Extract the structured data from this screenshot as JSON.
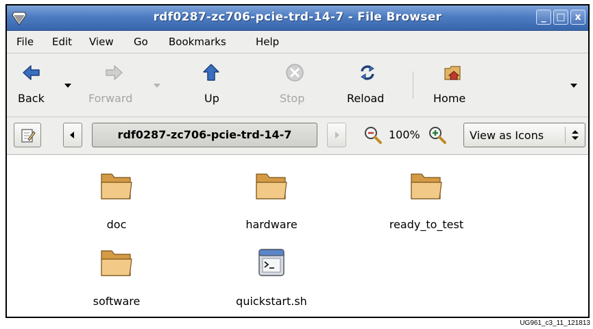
{
  "window": {
    "title": "rdf0287-zc706-pcie-trd-14-7 - File Browser"
  },
  "window_buttons": {
    "minimize": "_",
    "maximize": "□",
    "close": "x"
  },
  "menubar": {
    "items": [
      {
        "label": "File"
      },
      {
        "label": "Edit"
      },
      {
        "label": "View"
      },
      {
        "label": "Go"
      },
      {
        "label": "Bookmarks"
      },
      {
        "label": "Help"
      }
    ]
  },
  "toolbar": {
    "back": {
      "label": "Back",
      "icon": "back-arrow-icon",
      "enabled": true
    },
    "forward": {
      "label": "Forward",
      "icon": "forward-arrow-icon",
      "enabled": false
    },
    "up": {
      "label": "Up",
      "icon": "up-arrow-icon",
      "enabled": true
    },
    "stop": {
      "label": "Stop",
      "icon": "stop-icon",
      "enabled": false
    },
    "reload": {
      "label": "Reload",
      "icon": "reload-icon",
      "enabled": true
    },
    "home": {
      "label": "Home",
      "icon": "home-icon",
      "enabled": true
    }
  },
  "location": {
    "path_button": "rdf0287-zc706-pcie-trd-14-7",
    "zoom": "100%",
    "view_mode": "View as Icons"
  },
  "files": [
    {
      "name": "doc",
      "type": "folder"
    },
    {
      "name": "hardware",
      "type": "folder"
    },
    {
      "name": "ready_to_test",
      "type": "folder"
    },
    {
      "name": "software",
      "type": "folder"
    },
    {
      "name": "quickstart.sh",
      "type": "script"
    }
  ],
  "caption": "UG961_c3_11_121813",
  "colors": {
    "titlebar": "#4d7cc2",
    "chrome": "#eeeeec",
    "folder": "#e8b86a",
    "back_arrow": "#2f5fa8"
  }
}
